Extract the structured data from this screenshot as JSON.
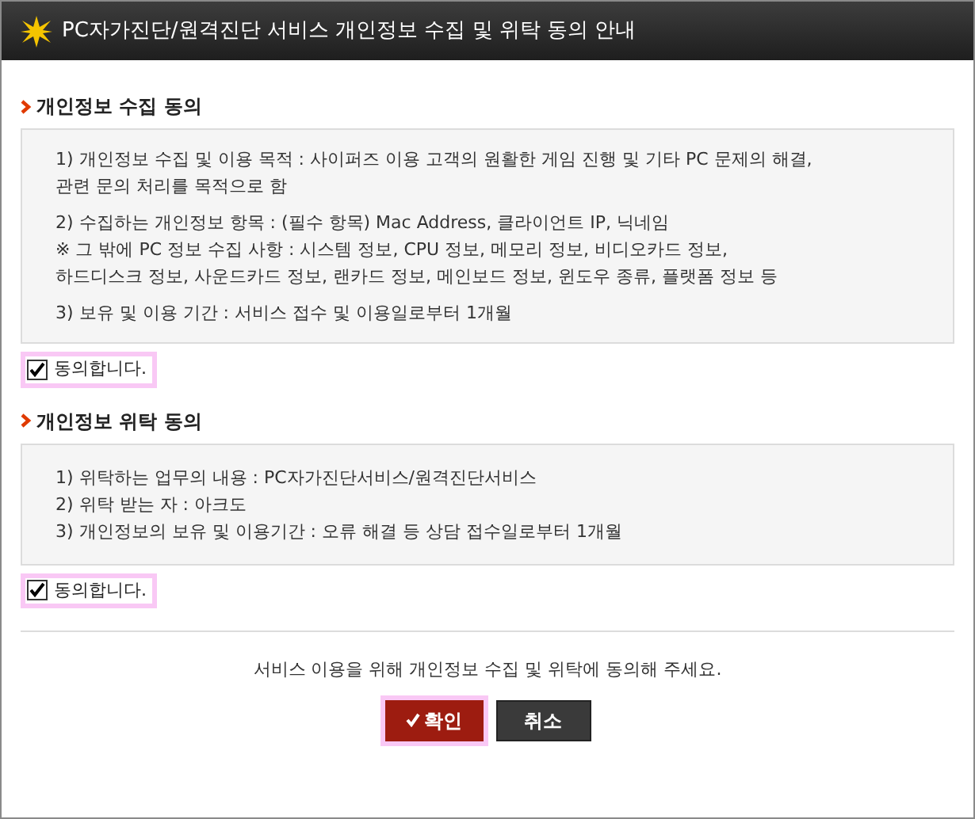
{
  "window": {
    "title": "PC자가진단/원격진단 서비스 개인정보 수집 및 위탁 동의 안내"
  },
  "sections": [
    {
      "heading": "개인정보 수집 동의",
      "paragraphs": [
        [
          "1) 개인정보 수집 및 이용 목적 : 사이퍼즈 이용 고객의 원활한 게임 진행 및 기타 PC 문제의 해결,",
          "관련 문의 처리를 목적으로 함"
        ],
        [
          "2) 수집하는 개인정보 항목 : (필수 항목) Mac Address, 클라이언트 IP, 닉네임",
          "※ 그 밖에 PC 정보 수집 사항 : 시스템 정보, CPU 정보, 메모리 정보, 비디오카드 정보,",
          "하드디스크 정보, 사운드카드 정보, 랜카드 정보, 메인보드 정보, 윈도우 종류, 플랫폼 정보 등"
        ],
        [
          "3) 보유 및 이용 기간 : 서비스 접수 및 이용일로부터 1개월"
        ]
      ],
      "agree": {
        "label": "동의합니다.",
        "checked": true
      }
    },
    {
      "heading": "개인정보 위탁 동의",
      "paragraphs": [
        [
          "1) 위탁하는 업무의 내용 : PC자가진단서비스/원격진단서비스",
          "2) 위탁 받는 자 : 아크도",
          "3) 개인정보의 보유 및 이용기간 : 오류 해결 등 상담 접수일로부터 1개월"
        ]
      ],
      "agree": {
        "label": "동의합니다.",
        "checked": true
      }
    }
  ],
  "notice": "서비스 이용을 위해 개인정보 수집 및 위탁에 동의해 주세요.",
  "buttons": [
    {
      "label": "확인",
      "kind": "confirm"
    },
    {
      "label": "취소",
      "kind": "cancel"
    }
  ]
}
